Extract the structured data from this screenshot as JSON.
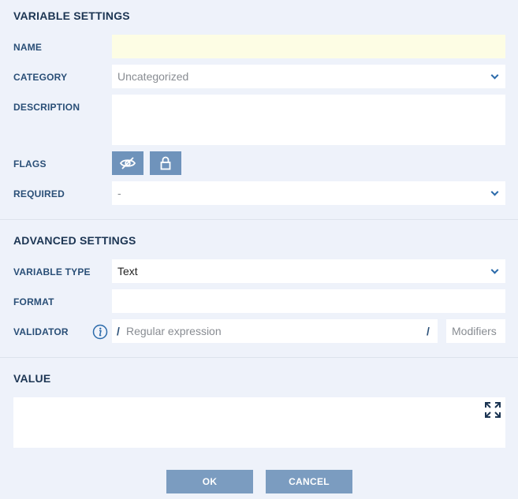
{
  "variable_settings": {
    "title": "VARIABLE SETTINGS",
    "name_label": "NAME",
    "name_value": "",
    "category_label": "CATEGORY",
    "category_value": "Uncategorized",
    "description_label": "DESCRIPTION",
    "description_value": "",
    "flags_label": "FLAGS",
    "required_label": "REQUIRED",
    "required_value": "-"
  },
  "advanced_settings": {
    "title": "ADVANCED SETTINGS",
    "variable_type_label": "VARIABLE TYPE",
    "variable_type_value": "Text",
    "format_label": "FORMAT",
    "format_value": "",
    "validator_label": "VALIDATOR",
    "validator_placeholder": "Regular expression",
    "modifiers_placeholder": "Modifiers",
    "slash": "/"
  },
  "value_section": {
    "title": "VALUE",
    "value": ""
  },
  "footer": {
    "ok_label": "OK",
    "cancel_label": "CANCEL"
  },
  "colors": {
    "background": "#eef2fa",
    "name_field": "#fdfde4",
    "flag_button": "#6f93bb",
    "action_button": "#7b9cc0",
    "label": "#2a4f77",
    "icon_blue": "#2a6aaa"
  },
  "icons": {
    "flag_hidden": "eye-off-icon",
    "flag_locked": "lock-icon",
    "info": "info-icon",
    "expand": "expand-icon",
    "dropdown": "chevron-down-icon"
  }
}
